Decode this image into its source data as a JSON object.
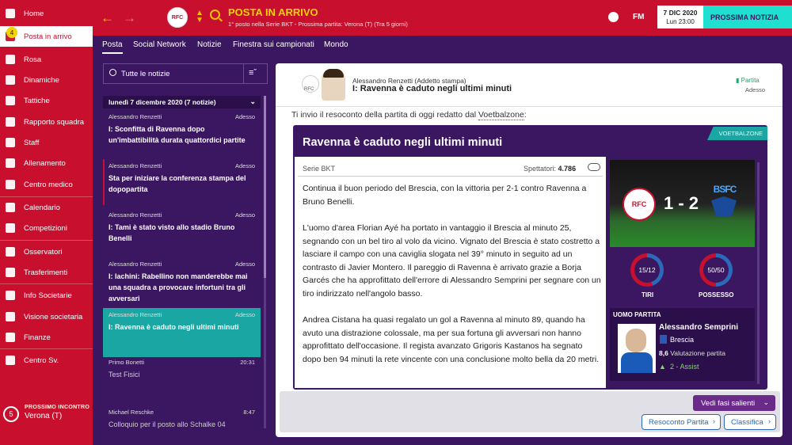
{
  "sidebar": {
    "items": [
      {
        "label": "Home",
        "icon": "home-icon"
      },
      {
        "label": "Posta in arrivo",
        "icon": "inbox-icon",
        "badge": "4"
      },
      {
        "label": "Rosa",
        "icon": "squad-icon"
      },
      {
        "label": "Dinamiche",
        "icon": "dynamics-icon"
      },
      {
        "label": "Tattiche",
        "icon": "tactics-icon"
      },
      {
        "label": "Rapporto squadra",
        "icon": "report-icon"
      },
      {
        "label": "Staff",
        "icon": "staff-icon"
      },
      {
        "label": "Allenamento",
        "icon": "training-icon"
      },
      {
        "label": "Centro medico",
        "icon": "medical-icon"
      },
      {
        "label": "Calendario",
        "icon": "calendar-icon"
      },
      {
        "label": "Competizioni",
        "icon": "trophy-icon"
      },
      {
        "label": "Osservatori",
        "icon": "scouting-icon"
      },
      {
        "label": "Trasferimenti",
        "icon": "transfers-icon"
      },
      {
        "label": "Info Societarie",
        "icon": "club-info-icon"
      },
      {
        "label": "Visione societaria",
        "icon": "vision-icon"
      },
      {
        "label": "Finanze",
        "icon": "finances-icon"
      },
      {
        "label": "Centro Sv.",
        "icon": "development-icon"
      }
    ],
    "next_match": {
      "label": "PROSSIMO INCONTRO",
      "opponent": "Verona (T)",
      "days": "5"
    }
  },
  "topbar": {
    "title": "POSTA IN ARRIVO",
    "subtitle": "1° posto nella Serie BKT - Prossima partita: Verona (T) (Tra 5 giorni)",
    "crest": "RFC",
    "fm": "FM",
    "date": "7 DIC 2020",
    "day_time": "Lun 23:00",
    "next_button": "PROSSIMA NOTIZIA"
  },
  "tabs": [
    "Posta",
    "Social Network",
    "Notizie",
    "Finestra sui campionati",
    "Mondo"
  ],
  "inbox": {
    "filter_label": "Tutte le notizie",
    "group_header": "lunedì 7 dicembre 2020 (7 notizie)",
    "messages": [
      {
        "from": "Alessandro Renzetti",
        "time": "Adesso",
        "subject": "I: Sconfitta di Ravenna dopo un'imbattibilità durata quattordici partite"
      },
      {
        "from": "Alessandro Renzetti",
        "time": "Adesso",
        "subject": "Sta per iniziare la conferenza stampa del dopopartita"
      },
      {
        "from": "Alessandro Renzetti",
        "time": "Adesso",
        "subject": "I: Tami è stato visto allo stadio Bruno Benelli"
      },
      {
        "from": "Alessandro Renzetti",
        "time": "Adesso",
        "subject": "I: Iachini: Rabellino non manderebbe mai una squadra a provocare infortuni tra gli avversari"
      },
      {
        "from": "Alessandro Renzetti",
        "time": "Adesso",
        "subject": "I: Ravenna è caduto negli ultimi minuti"
      },
      {
        "from": "Primo Bonetti",
        "time": "20:31",
        "subject": "Test Fisici"
      },
      {
        "from": "Michael Reschke",
        "time": "8:47",
        "subject": "Colloquio per il posto allo Schalke 04"
      }
    ]
  },
  "message": {
    "crest": "RFC",
    "from": "Alessandro Renzetti (Addetto stampa)",
    "subject": "I: Ravenna è caduto negli ultimi minuti",
    "tag": "Partita",
    "time": "Adesso",
    "intro_pre": "Ti invio il resoconto della partita di oggi redatto dal ",
    "intro_link": "Voetbalzone",
    "intro_post": ":"
  },
  "article": {
    "source": "VOETBALZONE",
    "title": "Ravenna è caduto negli ultimi minuti",
    "league": "Serie BKT",
    "spectators_label": "Spettatori:",
    "spectators": "4.786",
    "paragraphs": [
      "Continua il buon periodo del Brescia, con la vittoria per 2-1 contro Ravenna a Bruno Benelli.",
      "L'uomo d'area Florian Ayé ha portato in vantaggio il Brescia al minuto 25, segnando con un bel tiro al volo da vicino. Vignato del Brescia è stato costretto a lasciare il campo con una caviglia slogata nel 39° minuto in seguito ad un contrasto di Javier Montero. Il pareggio di Ravenna è arrivato grazie a Borja Garcés che ha approfittato dell'errore di Alessandro Semprini per segnare con un tiro indirizzato nell'angolo basso.",
      "Andrea Cistana ha quasi regalato un gol a Ravenna al minuto 89, quando ha avuto una distrazione colossale, ma per sua fortuna gli avversari non hanno approfittato dell'occasione. Il regista avanzato Grigoris Kastanos ha segnato dopo ben 94 minuti la rete vincente con una conclusione molto bella da 20 metri."
    ]
  },
  "scoreboard": {
    "home_crest": "RFC",
    "away_crest": "BSFC",
    "score": "1 - 2",
    "shots_value": "15/12",
    "shots_label": "TIRI",
    "possession_value": "50/50",
    "possession_label": "POSSESSO",
    "shots_home_frac": 0.556,
    "possession_home_frac": 0.5,
    "home_color": "#c8102e",
    "away_color": "#2a6ab8"
  },
  "motm": {
    "label": "UOMO PARTITA",
    "name": "Alessandro Semprini",
    "club": "Brescia",
    "rating": "8,6",
    "rating_label": "Valutazione partita",
    "assists": "2 - Assist"
  },
  "footer": {
    "highlights": "Vedi fasi salienti",
    "report": "Resoconto Partita",
    "table": "Classifica"
  },
  "colors": {
    "brand_red": "#c8102e",
    "brand_purple": "#3a1760",
    "teal": "#1aa7a3",
    "yellow": "#f5d300"
  }
}
